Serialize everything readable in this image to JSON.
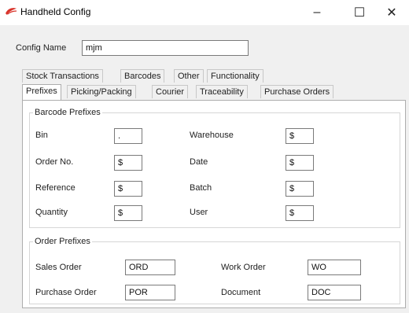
{
  "window": {
    "title": "Handheld Config",
    "minimize_glyph": "–",
    "maximize_glyph": "☐",
    "close_glyph": "✕"
  },
  "config_name": {
    "label": "Config Name",
    "value": "mjm"
  },
  "tabs_row1": [
    "Stock Transactions",
    "Barcodes",
    "Other",
    "Functionality"
  ],
  "tabs_row2": [
    "Prefixes",
    "Picking/Packing",
    "Courier",
    "Traceability",
    "Purchase Orders"
  ],
  "active_tab": "Prefixes",
  "barcode_prefixes": {
    "title": "Barcode Prefixes",
    "fields": [
      {
        "label": "Bin",
        "value": "."
      },
      {
        "label": "Order No.",
        "value": "$"
      },
      {
        "label": "Reference",
        "value": "$"
      },
      {
        "label": "Quantity",
        "value": "$"
      },
      {
        "label": "Warehouse",
        "value": "$"
      },
      {
        "label": "Date",
        "value": "$"
      },
      {
        "label": "Batch",
        "value": "$"
      },
      {
        "label": "User",
        "value": "$"
      }
    ]
  },
  "order_prefixes": {
    "title": "Order Prefixes",
    "fields": [
      {
        "label": "Sales Order",
        "value": "ORD"
      },
      {
        "label": "Purchase Order",
        "value": "POR"
      },
      {
        "label": "Work Order",
        "value": "WO"
      },
      {
        "label": "Document",
        "value": "DOC"
      }
    ]
  },
  "colors": {
    "titlebar": "#ffffff",
    "window_bg": "#f0f0f0",
    "panel_bg": "#ffffff",
    "icon_red": "#d9342b"
  }
}
